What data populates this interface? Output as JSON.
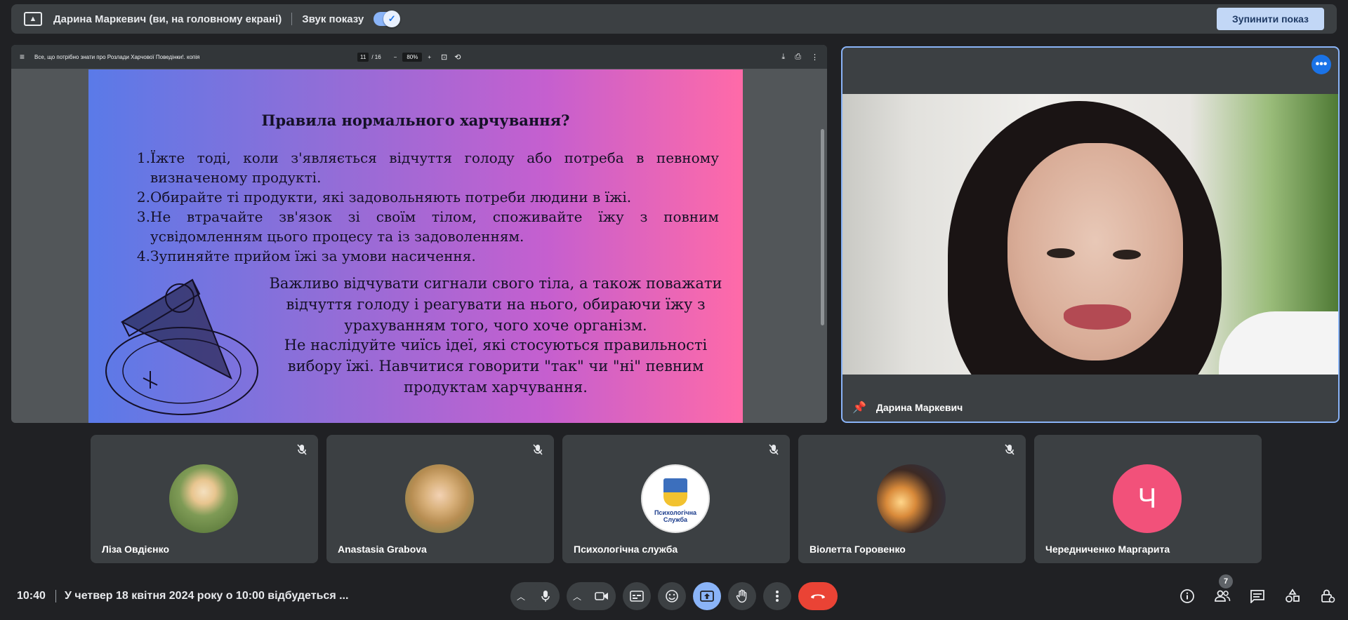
{
  "topbar": {
    "presenter_title": "Дарина Маркевич (ви, на головному екрані)",
    "sound_label": "Звук показу",
    "stop_label": "Зупинити показ"
  },
  "pdf": {
    "filename": "Все, що потрібно знати про Розлади Харчової Поведінки!. копія",
    "current_page": "11",
    "total_pages": "/ 16",
    "zoom": "80%"
  },
  "slide": {
    "title": "Правила нормального харчування?",
    "items": [
      {
        "num": "1.",
        "text": "Їжте тоді, коли з'являється відчуття голоду або потреба в певному визначеному продукті."
      },
      {
        "num": "2.",
        "text": "Обирайте ті продукти, які задовольняють потреби людини в їжі."
      },
      {
        "num": "3.",
        "text": "Не втрачайте зв'язок зі своїм тілом, споживайте їжу з повним усвідомленням цього процесу та із задоволенням."
      },
      {
        "num": "4.",
        "text": "Зупиняйте прийом їжі за умови насичення."
      }
    ],
    "para1": "Важливо відчувати сигнали свого тіла, а також поважати відчуття голоду і реагувати на нього, обираючи їжу з урахуванням того, чого хоче організм.",
    "para2": "Не наслідуйте чиїсь ідеї, які стосуються правильності вибору їжі. Навчитися говорити \"так\" чи \"ні\" певним продуктам харчування."
  },
  "speaker": {
    "name": "Дарина Маркевич"
  },
  "participants": [
    {
      "name": "Ліза Овдієнко"
    },
    {
      "name": "Anastasia Grabova"
    },
    {
      "name": "Психологічна служба",
      "avatar_text": "Психологічна Служба"
    },
    {
      "name": "Віолетта Горовенко"
    },
    {
      "name": "Чередниченко Маргарита",
      "initial": "Ч"
    }
  ],
  "bottombar": {
    "clock": "10:40",
    "meeting_title": "У четвер 18 квітня 2024 року о 10:00 відбудеться ...",
    "participants_count": "7"
  },
  "colors": {
    "accent": "#8ab4f8",
    "end_call": "#ea4335",
    "avatar_pink": "#f2517a"
  },
  "icons": [
    "present-icon",
    "check-icon",
    "menu-icon",
    "download-icon",
    "print-icon",
    "more-vert-icon",
    "pin-icon",
    "mic-off-icon",
    "mic-icon",
    "camera-icon",
    "captions-icon",
    "emoji-icon",
    "present-now-icon",
    "raise-hand-icon",
    "more-options-icon",
    "end-call-icon",
    "info-icon",
    "people-icon",
    "chat-icon",
    "activities-icon",
    "host-controls-icon"
  ]
}
